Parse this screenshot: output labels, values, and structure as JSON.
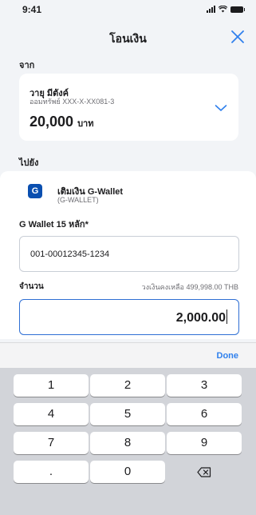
{
  "status_bar": {
    "time": "9:41"
  },
  "header": {
    "title": "โอนเงิน"
  },
  "from": {
    "section_label": "จาก",
    "account_name": "วายุ มีตังค์",
    "account_number": "ออมทรัพย์ XXX-X-XX081-3",
    "balance_amount": "20,000",
    "currency_unit": "บาท"
  },
  "to": {
    "section_label": "ไปยัง",
    "destination_icon_letter": "G",
    "destination_name": "เติมเงิน G-Wallet",
    "destination_code": "(G-WALLET)"
  },
  "wallet_field": {
    "label": "G Wallet 15 หลัก",
    "required_mark": "*",
    "value": "001-00012345-1234"
  },
  "amount_field": {
    "label": "จำนวน",
    "available_balance": "วงเงินคงเหลือ 499,998.00 THB",
    "value": "2,000.00"
  },
  "keyboard": {
    "done_label": "Done",
    "keys": [
      "1",
      "2",
      "3",
      "4",
      "5",
      "6",
      "7",
      "8",
      "9",
      ".",
      "0"
    ]
  },
  "colors": {
    "accent": "#2f80ed",
    "close_icon": "#2f80ed",
    "g_wallet_brand": "#0a4fb0",
    "page_background": "#f2f4f7",
    "keyboard_background": "#d2d4d9"
  }
}
